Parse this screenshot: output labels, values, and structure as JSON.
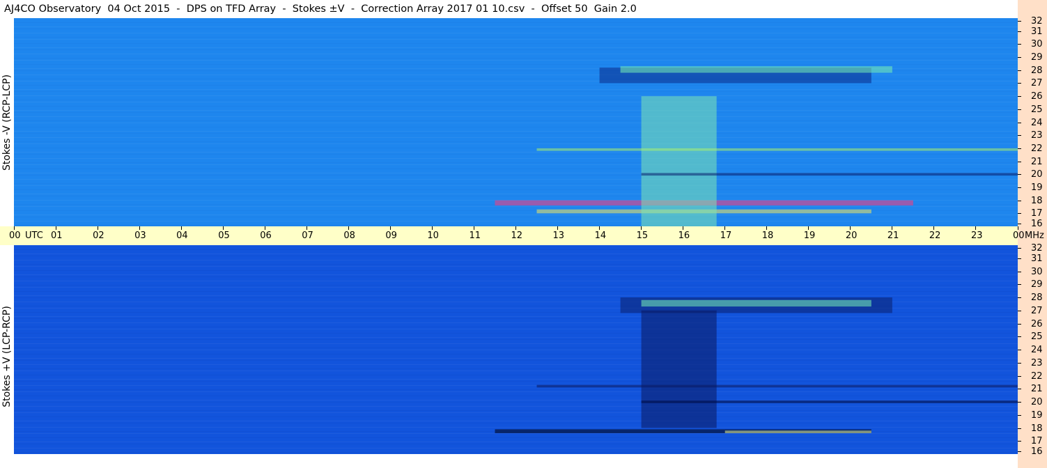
{
  "title": "AJ4CO Observatory  04 Oct 2015  -  DPS on TFD Array  -  Stokes ±V  -  Correction Array 2017 01 10.csv  -  Offset 50  Gain 2.0",
  "colors": {
    "top_background": "#1e86ee",
    "bottom_background": "#1254dc",
    "time_axis_bg": "#ffffc8",
    "freq_axis_bg": "#ffe0c8"
  },
  "chart_data": [
    {
      "type": "heatmap",
      "panel": "top",
      "ylabel": "Stokes -V (RCP-LCP)",
      "y_unit": "MHz",
      "y_range": [
        16,
        32
      ],
      "y_ticks": [
        "32",
        "31",
        "30",
        "29",
        "28",
        "27",
        "26",
        "25",
        "24",
        "23",
        "22",
        "21",
        "20",
        "19",
        "18",
        "17",
        "16"
      ],
      "x_range_hours": [
        0,
        24
      ],
      "features": [
        {
          "kind": "band",
          "t0": 11.5,
          "t1": 21.5,
          "f0": 17.6,
          "f1": 18.0,
          "color": "#ff3b7a"
        },
        {
          "kind": "band",
          "t0": 12.5,
          "t1": 20.5,
          "f0": 17.0,
          "f1": 17.3,
          "color": "#f0e860"
        },
        {
          "kind": "band",
          "t0": 14.0,
          "t1": 20.5,
          "f0": 27.0,
          "f1": 28.2,
          "color": "#0a2a8a"
        },
        {
          "kind": "band",
          "t0": 14.5,
          "t1": 21.0,
          "f0": 27.8,
          "f1": 28.3,
          "color": "#78f0b4"
        },
        {
          "kind": "band",
          "t0": 15.0,
          "t1": 16.8,
          "f0": 16.0,
          "f1": 26.0,
          "color": "#7ee6b4"
        },
        {
          "kind": "band",
          "t0": 12.5,
          "t1": 24.0,
          "f0": 21.8,
          "f1": 22.0,
          "color": "#a8f070"
        },
        {
          "kind": "band",
          "t0": 15.0,
          "t1": 24.0,
          "f0": 19.9,
          "f1": 20.1,
          "color": "#0a1f6e"
        }
      ]
    },
    {
      "type": "heatmap",
      "panel": "bottom",
      "ylabel": "Stokes +V (LCP-RCP)",
      "y_unit": "MHz",
      "y_range": [
        16,
        32
      ],
      "y_ticks": [
        "32",
        "31",
        "30",
        "29",
        "28",
        "27",
        "26",
        "25",
        "24",
        "23",
        "22",
        "21",
        "20",
        "19",
        "18",
        "17",
        "16"
      ],
      "x_range_hours": [
        0,
        24
      ],
      "features": [
        {
          "kind": "band",
          "t0": 11.5,
          "t1": 20.5,
          "f0": 17.6,
          "f1": 17.9,
          "color": "#000010"
        },
        {
          "kind": "band",
          "t0": 17.0,
          "t1": 20.5,
          "f0": 17.6,
          "f1": 17.8,
          "color": "#e8f090"
        },
        {
          "kind": "band",
          "t0": 14.5,
          "t1": 21.0,
          "f0": 26.8,
          "f1": 28.0,
          "color": "#0a1f6e"
        },
        {
          "kind": "band",
          "t0": 15.0,
          "t1": 20.5,
          "f0": 27.3,
          "f1": 27.8,
          "color": "#78f0b4"
        },
        {
          "kind": "band",
          "t0": 15.0,
          "t1": 16.8,
          "f0": 18.0,
          "f1": 27.0,
          "color": "#0a1860"
        },
        {
          "kind": "band",
          "t0": 12.5,
          "t1": 24.0,
          "f0": 21.1,
          "f1": 21.3,
          "color": "#0a1860"
        },
        {
          "kind": "band",
          "t0": 15.0,
          "t1": 24.0,
          "f0": 19.9,
          "f1": 20.1,
          "color": "#000a40"
        }
      ]
    }
  ],
  "time_axis": {
    "labels": [
      "00",
      "01",
      "02",
      "03",
      "04",
      "05",
      "06",
      "07",
      "08",
      "09",
      "10",
      "11",
      "12",
      "13",
      "14",
      "15",
      "16",
      "17",
      "18",
      "19",
      "20",
      "21",
      "22",
      "23",
      "00"
    ],
    "utc_label": "UTC",
    "mhz_label": "MHz"
  }
}
